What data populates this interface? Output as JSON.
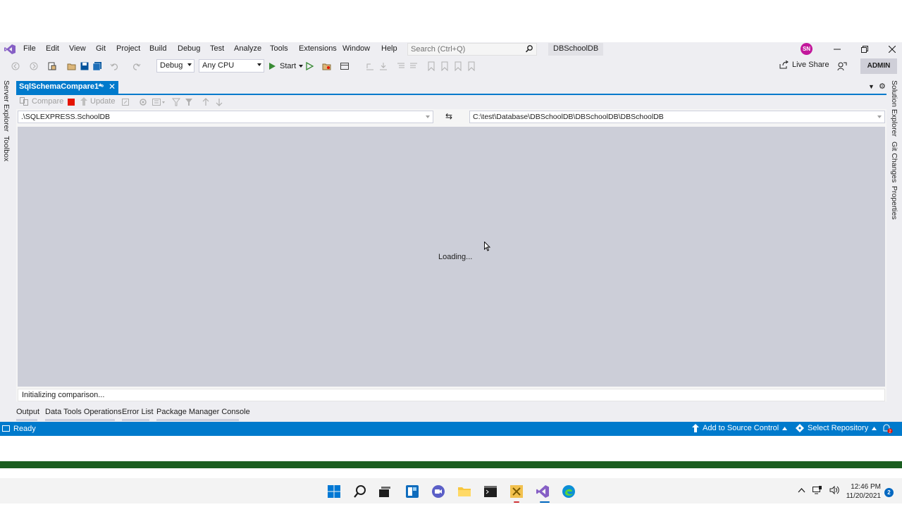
{
  "menu": {
    "items": [
      "File",
      "Edit",
      "View",
      "Git",
      "Project",
      "Build",
      "Debug",
      "Test",
      "Analyze",
      "Tools",
      "Extensions",
      "Window",
      "Help"
    ],
    "search_placeholder": "Search (Ctrl+Q)",
    "solution_name": "DBSchoolDB",
    "avatar_initials": "SN"
  },
  "toolbar": {
    "configuration": "Debug",
    "platform": "Any CPU",
    "start_label": "Start",
    "live_share_label": "Live Share",
    "admin_label": "ADMIN"
  },
  "side_tabs": {
    "left": [
      "Server Explorer",
      "Toolbox"
    ],
    "right": [
      "Solution Explorer",
      "Git Changes",
      "Properties"
    ]
  },
  "document": {
    "tab_title": "SqlSchemaCompare1*",
    "compare_label": "Compare",
    "update_label": "Update",
    "source": ".\\SQLEXPRESS.SchoolDB",
    "target": "C:\\test\\Database\\DBSchoolDB\\DBSchoolDB\\DBSchoolDB",
    "loading_text": "Loading...",
    "status_text": "Initializing comparison..."
  },
  "bottom_tabs": [
    "Output",
    "Data Tools Operations",
    "Error List",
    "Package Manager Console"
  ],
  "statusbar": {
    "ready": "Ready",
    "source_control": "Add to Source Control",
    "repository": "Select Repository",
    "notification_count": "2"
  },
  "taskbar": {
    "time": "12:46 PM",
    "date": "11/20/2021",
    "notification_count": "2"
  },
  "colors": {
    "accent": "#007acc",
    "chrome": "#eeeef2",
    "results_bg": "#ccced8",
    "stop_red": "#e51400",
    "play_green": "#388a34"
  }
}
